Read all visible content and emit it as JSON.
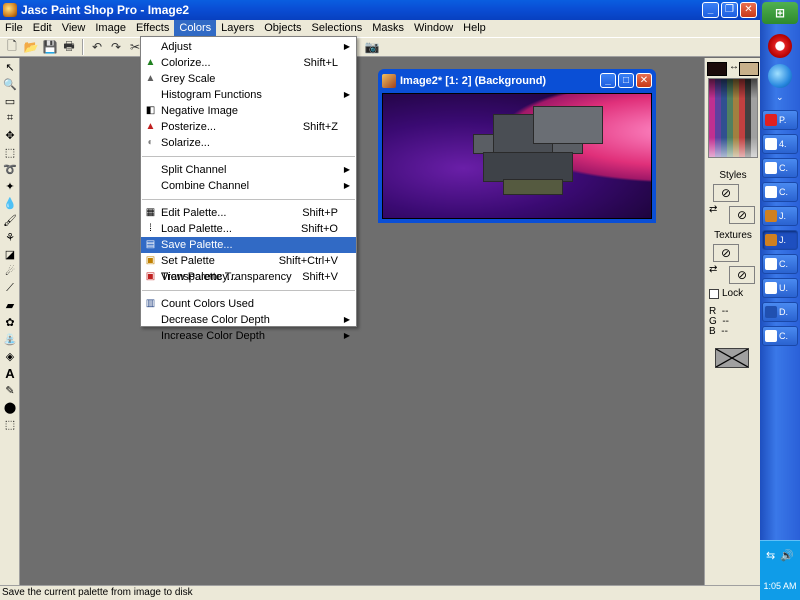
{
  "window": {
    "title": "Jasc Paint Shop Pro - Image2"
  },
  "menubar": [
    "File",
    "Edit",
    "View",
    "Image",
    "Effects",
    "Colors",
    "Layers",
    "Objects",
    "Selections",
    "Masks",
    "Window",
    "Help"
  ],
  "colors_menu": {
    "items": [
      {
        "label": "Adjust",
        "shortcut": "",
        "submenu": true,
        "icon": ""
      },
      {
        "label": "Colorize...",
        "shortcut": "Shift+L",
        "submenu": false,
        "icon": "colorize-icon"
      },
      {
        "label": "Grey Scale",
        "shortcut": "",
        "submenu": false,
        "icon": "greyscale-icon"
      },
      {
        "label": "Histogram Functions",
        "shortcut": "",
        "submenu": true,
        "icon": ""
      },
      {
        "label": "Negative Image",
        "shortcut": "",
        "submenu": false,
        "icon": "negative-icon"
      },
      {
        "label": "Posterize...",
        "shortcut": "Shift+Z",
        "submenu": false,
        "icon": "posterize-icon"
      },
      {
        "label": "Solarize...",
        "shortcut": "",
        "submenu": false,
        "icon": "solarize-icon"
      },
      {
        "label": "Split Channel",
        "shortcut": "",
        "submenu": true,
        "icon": ""
      },
      {
        "label": "Combine Channel",
        "shortcut": "",
        "submenu": true,
        "icon": ""
      },
      {
        "label": "Edit Palette...",
        "shortcut": "Shift+P",
        "submenu": false,
        "icon": "edit-palette-icon"
      },
      {
        "label": "Load Palette...",
        "shortcut": "Shift+O",
        "submenu": false,
        "icon": "load-palette-icon"
      },
      {
        "label": "Save Palette...",
        "shortcut": "",
        "submenu": false,
        "icon": "save-palette-icon"
      },
      {
        "label": "Set Palette Transparency...",
        "shortcut": "Shift+Ctrl+V",
        "submenu": false,
        "icon": "set-transparency-icon"
      },
      {
        "label": "View Palette Transparency",
        "shortcut": "Shift+V",
        "submenu": false,
        "icon": "view-transparency-icon"
      },
      {
        "label": "Count Colors Used",
        "shortcut": "",
        "submenu": false,
        "icon": "count-colors-icon"
      },
      {
        "label": "Decrease Color Depth",
        "shortcut": "",
        "submenu": true,
        "icon": ""
      },
      {
        "label": "Increase Color Depth",
        "shortcut": "",
        "submenu": true,
        "icon": ""
      }
    ]
  },
  "image_window": {
    "title": "Image2* [1: 2] (Background)"
  },
  "right_panel": {
    "styles_label": "Styles",
    "textures_label": "Textures",
    "lock_label": "Lock",
    "r_label": "R",
    "g_label": "G",
    "b_label": "B",
    "rgb_value": "--"
  },
  "taskbar": {
    "start_label": "",
    "clock": "1:05 AM",
    "tasks": [
      {
        "label": "P."
      },
      {
        "label": "4."
      },
      {
        "label": "C."
      },
      {
        "label": "C."
      },
      {
        "label": "J."
      },
      {
        "label": "J."
      },
      {
        "label": "C."
      },
      {
        "label": "U."
      },
      {
        "label": "D."
      },
      {
        "label": "C."
      }
    ]
  },
  "status": {
    "text": "Save the current palette from image to disk"
  },
  "colors": {
    "accent": "#316ac5",
    "titlebar": "#0a4fd6",
    "workspace": "#6e6e6e",
    "fg_swatch": "#1a0a0a",
    "bg_swatch": "#c8b08a"
  }
}
